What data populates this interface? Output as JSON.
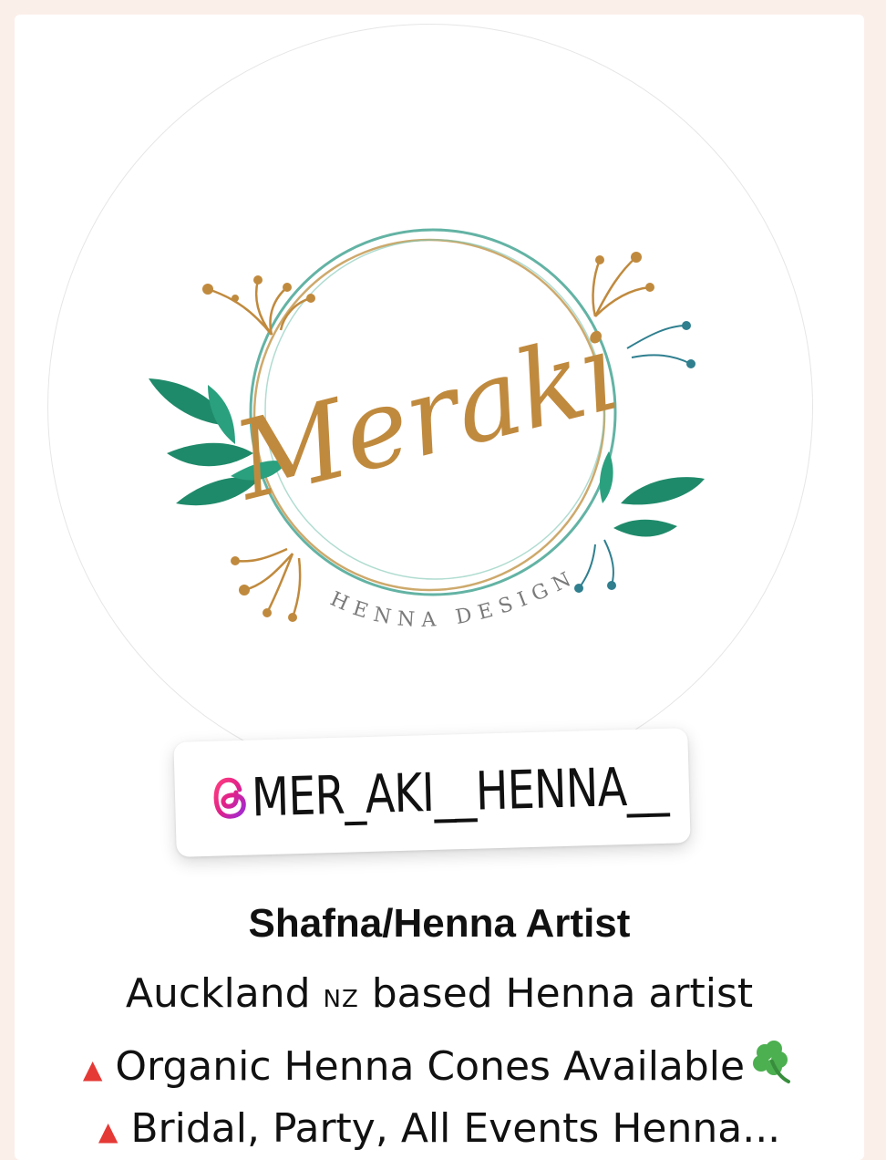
{
  "profile": {
    "logo_script": "Meraki",
    "logo_subtitle": "HENNA DESIGN",
    "handle": "@MER_AKI__HENNA__",
    "handle_text": "MER_AKI__HENNA__",
    "name": "Shafna/Henna Artist",
    "bio": {
      "line1_a": "Auckland ",
      "line1_nz": "NZ",
      "line1_b": " based Henna artist",
      "line2": "Organic Henna Cones Available",
      "line3": "Bridal, Party, All Events Henna..."
    }
  },
  "icons": {
    "handle_icon": "threads-icon",
    "bullet": "red-triangle-icon",
    "clover": "shamrock-icon"
  },
  "colors": {
    "background": "#fbefea",
    "gold": "#c08a3e",
    "leaf_green": "#1f8a6a",
    "triangle_red": "#e53935"
  }
}
